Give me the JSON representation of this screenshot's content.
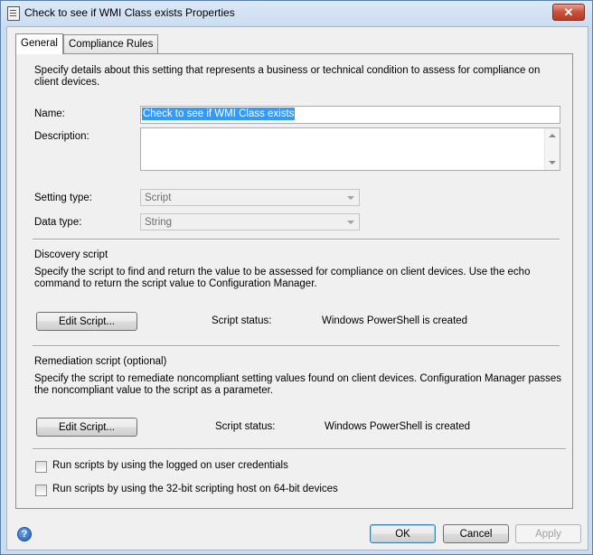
{
  "window": {
    "title": "Check to see if WMI Class exists Properties",
    "close_symbol": "✕"
  },
  "tabs": [
    {
      "label": "General",
      "active": true
    },
    {
      "label": "Compliance Rules",
      "active": false
    }
  ],
  "general": {
    "intro": "Specify details about this setting that represents a business or technical condition to assess for compliance on client devices.",
    "name_label": "Name:",
    "name_value": "Check to see if WMI Class exists",
    "description_label": "Description:",
    "description_value": "",
    "setting_type_label": "Setting type:",
    "setting_type_value": "Script",
    "data_type_label": "Data type:",
    "data_type_value": "String"
  },
  "discovery": {
    "heading": "Discovery script",
    "description": "Specify the script to find and return the value to be assessed for compliance on client devices. Use the echo command to return the script value to Configuration Manager.",
    "edit_button": "Edit Script...",
    "status_label": "Script status:",
    "status_value": "Windows PowerShell is created"
  },
  "remediation": {
    "heading": "Remediation script (optional)",
    "description": "Specify the script to remediate noncompliant setting values found on client devices. Configuration Manager passes the noncompliant value to the script as a parameter.",
    "edit_button": "Edit Script...",
    "status_label": "Script status:",
    "status_value": "Windows PowerShell is created"
  },
  "options": {
    "logged_on_credentials": {
      "label": "Run scripts by using the logged on user credentials",
      "checked": false
    },
    "scripting_host_32bit": {
      "label": "Run scripts by using the 32-bit scripting host on 64-bit devices",
      "checked": false
    }
  },
  "footer": {
    "help_symbol": "?",
    "ok": "OK",
    "cancel": "Cancel",
    "apply": "Apply"
  },
  "icons": {
    "title": "properties-window-icon",
    "help": "help-icon",
    "close": "close-icon"
  }
}
